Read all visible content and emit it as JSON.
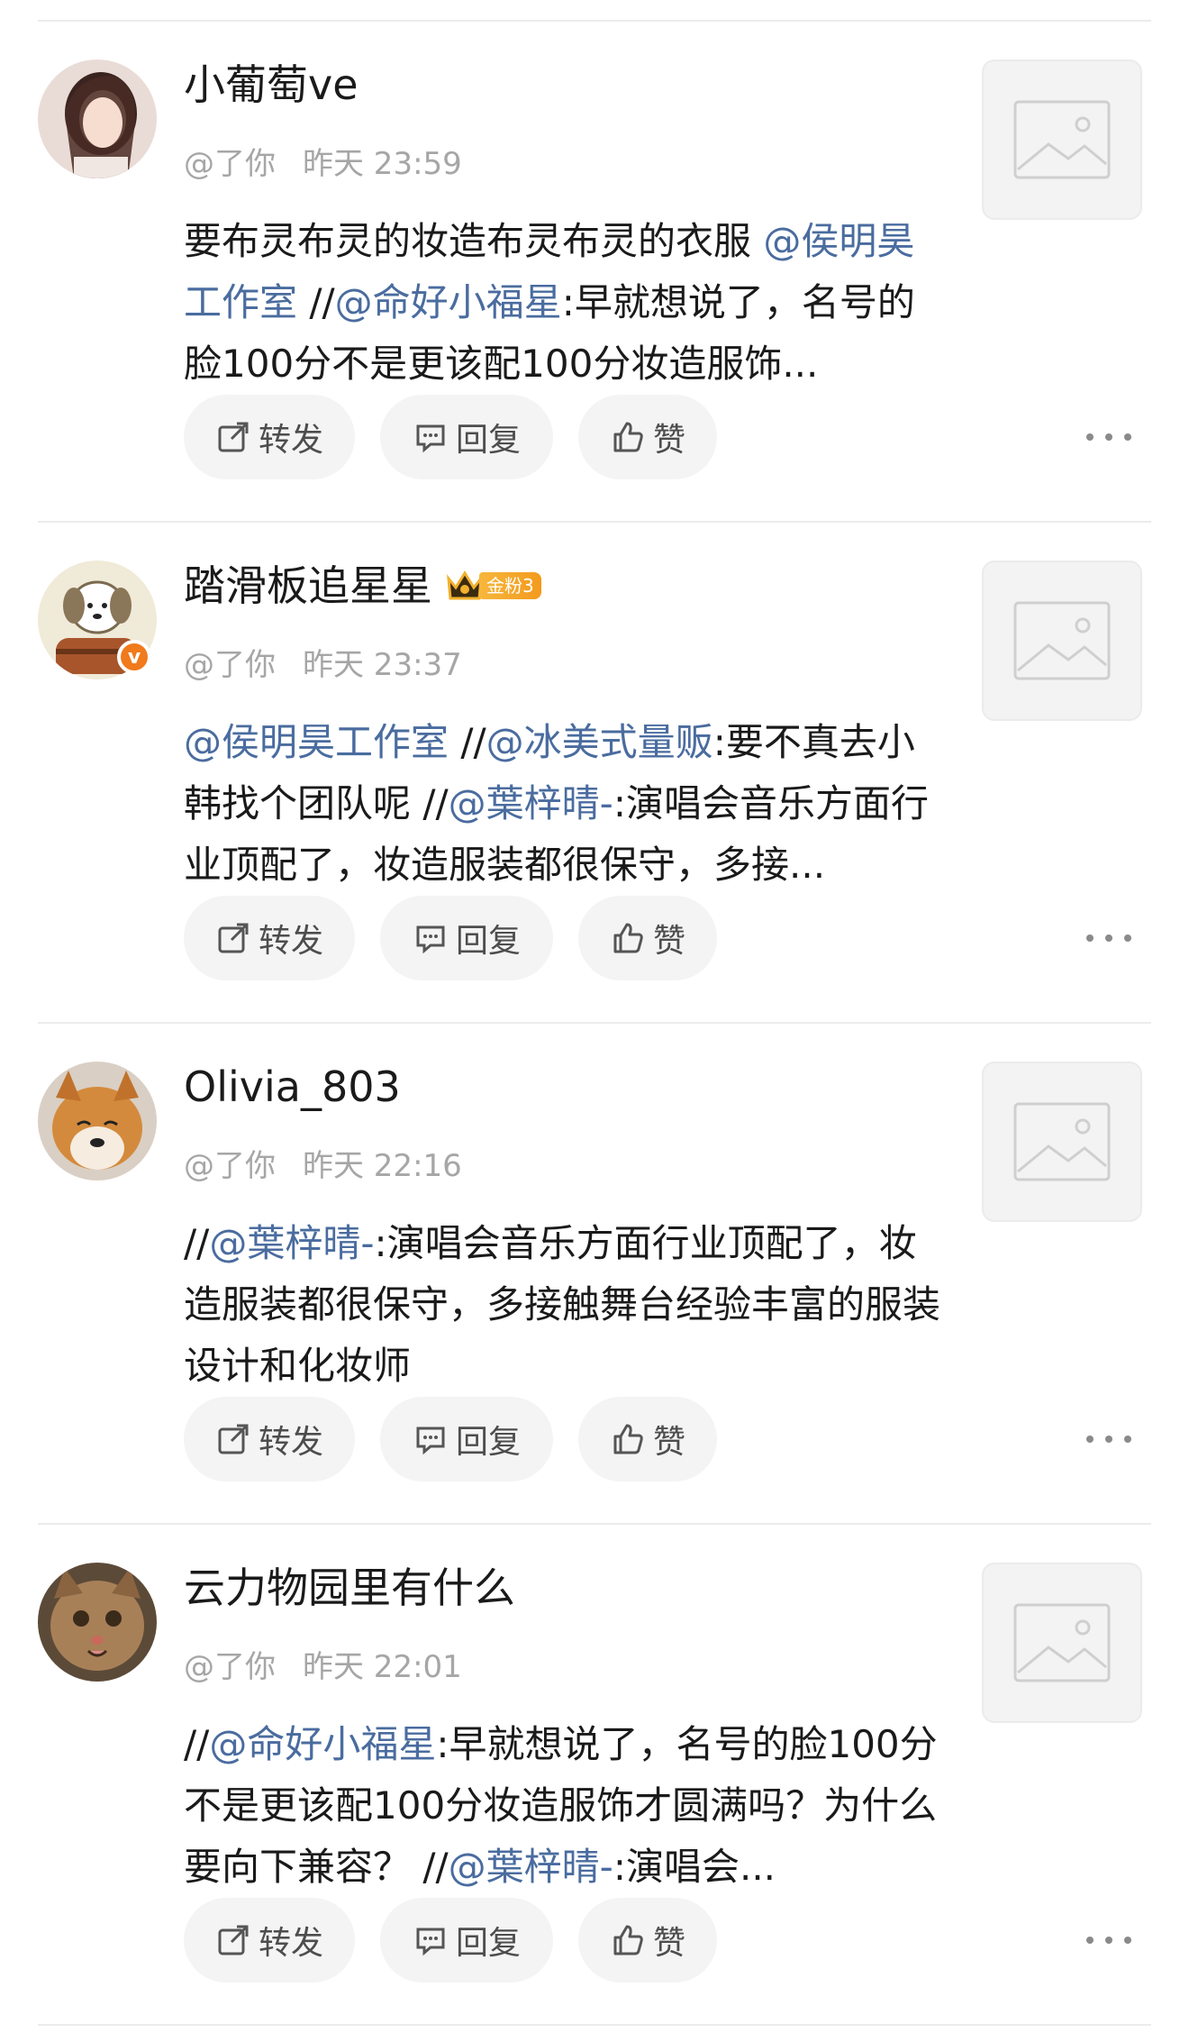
{
  "actions": {
    "repost": "转发",
    "reply": "回复",
    "like": "赞"
  },
  "colors": {
    "mention": "#4a6c9f",
    "meta": "#a6a6a6",
    "pill_bg": "#f4f4f4"
  },
  "comments": [
    {
      "name": "小葡萄ve",
      "at": "@了你",
      "time": "昨天 23:59",
      "content": [
        {
          "t": "text",
          "v": "要布灵布灵的妆造布灵布灵的衣服 "
        },
        {
          "t": "mention",
          "v": "@侯明昊工作室"
        },
        {
          "t": "text",
          "v": " //"
        },
        {
          "t": "mention",
          "v": "@命好小福星"
        },
        {
          "t": "text",
          "v": ":早就想说了，名号的脸100分不是更该配100分妆造服饰..."
        }
      ]
    },
    {
      "name": "踏滑板追星星",
      "fan_badge": "金粉3",
      "verified": "v",
      "at": "@了你",
      "time": "昨天 23:37",
      "content": [
        {
          "t": "mention",
          "v": "@侯明昊工作室"
        },
        {
          "t": "text",
          "v": " //"
        },
        {
          "t": "mention",
          "v": "@冰美式量贩"
        },
        {
          "t": "text",
          "v": ":要不真去小韩找个团队呢 //"
        },
        {
          "t": "mention",
          "v": "@葉梓晴-"
        },
        {
          "t": "text",
          "v": ":演唱会音乐方面行业顶配了，妆造服装都很保守，多接..."
        }
      ]
    },
    {
      "name": "Olivia_803",
      "at": "@了你",
      "time": "昨天 22:16",
      "content": [
        {
          "t": "text",
          "v": "//"
        },
        {
          "t": "mention",
          "v": "@葉梓晴-"
        },
        {
          "t": "text",
          "v": ":演唱会音乐方面行业顶配了，妆造服装都很保守，多接触舞台经验丰富的服装设计和化妆师"
        }
      ]
    },
    {
      "name": "云力物园里有什么",
      "at": "@了你",
      "time": "昨天 22:01",
      "content": [
        {
          "t": "text",
          "v": "//"
        },
        {
          "t": "mention",
          "v": "@命好小福星"
        },
        {
          "t": "text",
          "v": ":早就想说了，名号的脸100分不是更该配100分妆造服饰才圆满吗？为什么要向下兼容？ //"
        },
        {
          "t": "mention",
          "v": "@葉梓晴-"
        },
        {
          "t": "text",
          "v": ":演唱会..."
        }
      ]
    }
  ]
}
